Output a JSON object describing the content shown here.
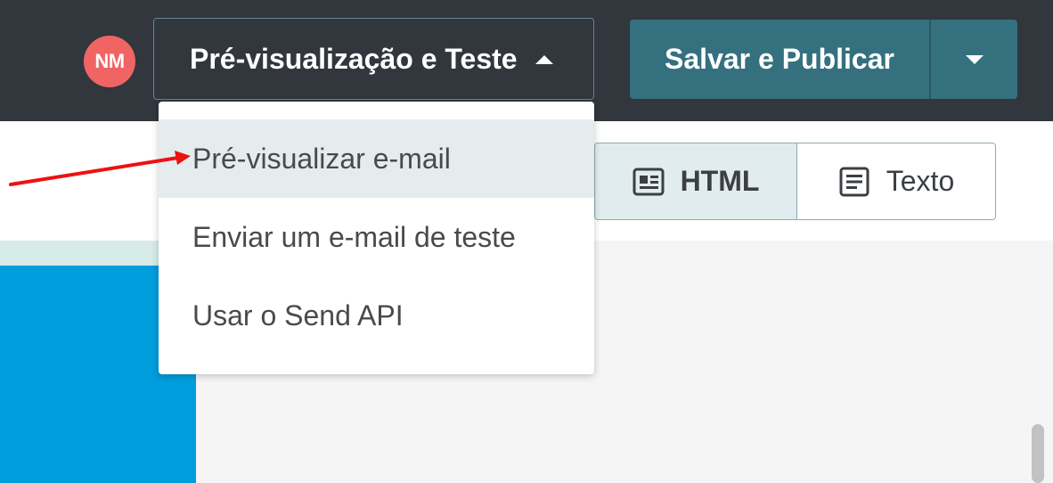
{
  "header": {
    "avatar_initials": "NM",
    "preview_button_label": "Pré-visualização e Teste",
    "save_button_label": "Salvar e Publicar"
  },
  "preview_menu": {
    "items": [
      {
        "label": "Pré-visualizar e-mail",
        "highlighted": true
      },
      {
        "label": "Enviar um e-mail de teste",
        "highlighted": false
      },
      {
        "label": "Usar o Send API",
        "highlighted": false
      }
    ]
  },
  "view_toggle": {
    "options": [
      {
        "label": "HTML",
        "icon": "html-view-icon",
        "selected": true
      },
      {
        "label": "Texto",
        "icon": "text-view-icon",
        "selected": false
      }
    ]
  },
  "annotation": {
    "arrow_color": "#ee1111"
  },
  "colors": {
    "topbar": "#32363d",
    "avatar": "#f16464",
    "save_button": "#35707f",
    "preview_block": "#009ddc"
  }
}
